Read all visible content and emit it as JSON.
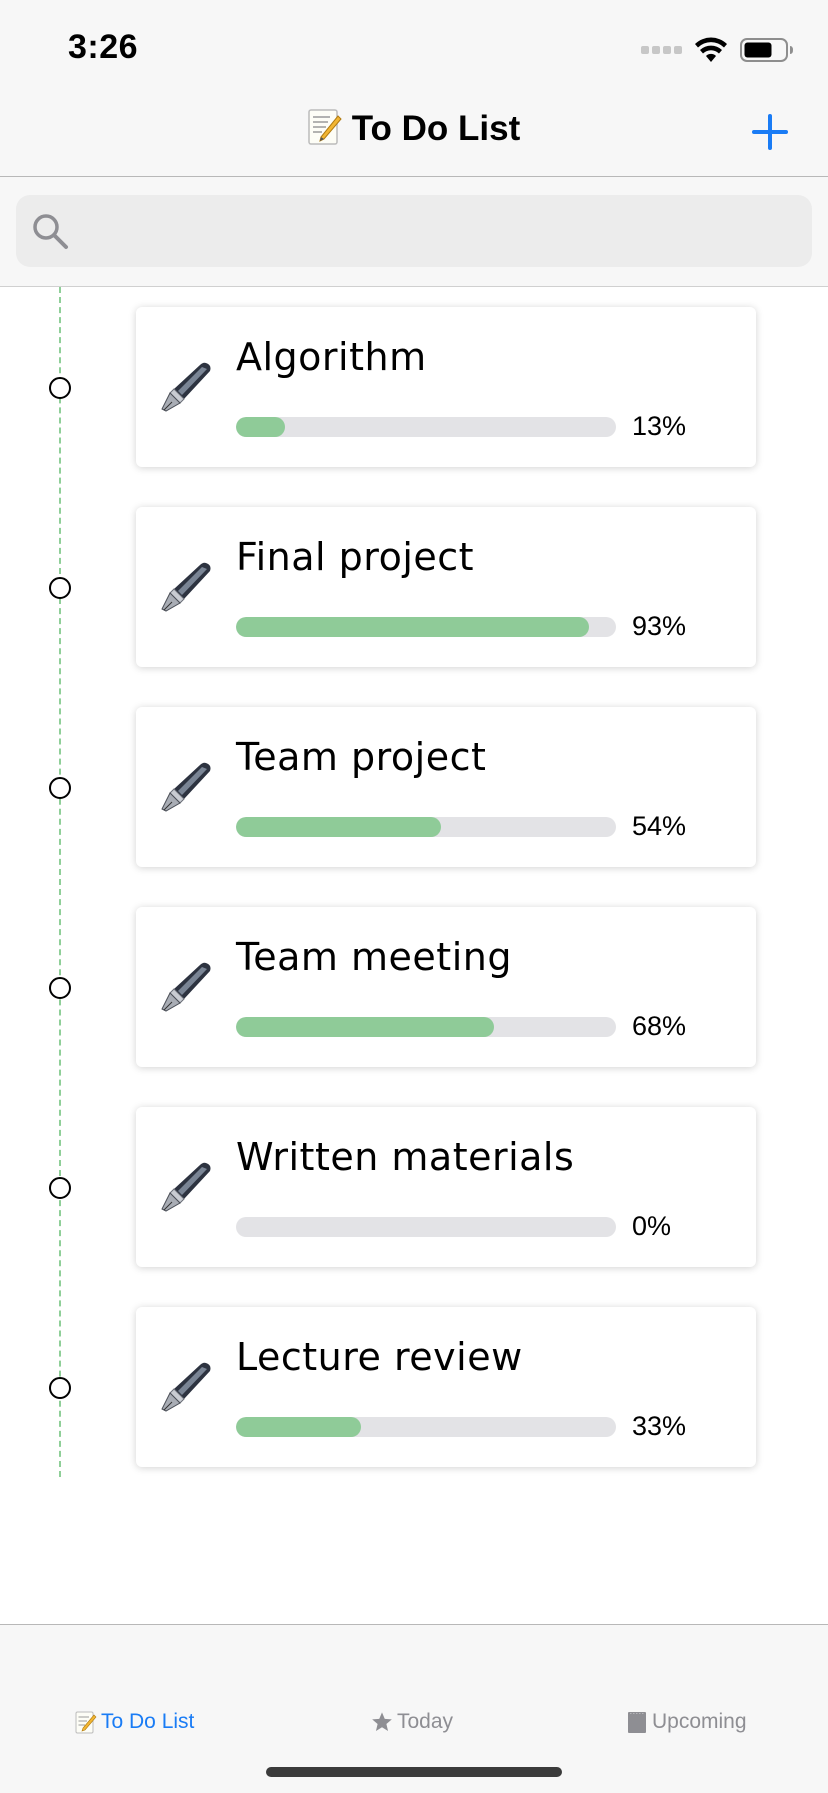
{
  "status_bar": {
    "time": "3:26"
  },
  "nav": {
    "title": "To Do List",
    "title_icon": "memo-icon",
    "add_icon": "plus-icon"
  },
  "search": {
    "placeholder": "",
    "value": ""
  },
  "colors": {
    "accent": "#1a7cf5",
    "progress_fill": "#8fcb98",
    "progress_track": "#e3e3e6",
    "timeline": "#8fcf98",
    "tab_inactive": "#8e8e93"
  },
  "tasks": [
    {
      "title": "Algorithm",
      "progress": 13,
      "progress_label": "13%",
      "icon": "fountain-pen-icon"
    },
    {
      "title": "Final project",
      "progress": 93,
      "progress_label": "93%",
      "icon": "fountain-pen-icon"
    },
    {
      "title": "Team project",
      "progress": 54,
      "progress_label": "54%",
      "icon": "fountain-pen-icon"
    },
    {
      "title": "Team meeting",
      "progress": 68,
      "progress_label": "68%",
      "icon": "fountain-pen-icon"
    },
    {
      "title": "Written materials",
      "progress": 0,
      "progress_label": "0%",
      "icon": "fountain-pen-icon"
    },
    {
      "title": "Lecture review",
      "progress": 33,
      "progress_label": "33%",
      "icon": "fountain-pen-icon"
    }
  ],
  "tab_bar": {
    "items": [
      {
        "label": "To Do List",
        "icon": "memo-icon",
        "selected": true
      },
      {
        "label": "Today",
        "icon": "star-icon",
        "selected": false
      },
      {
        "label": "Upcoming",
        "icon": "notepad-icon",
        "selected": false
      }
    ]
  }
}
